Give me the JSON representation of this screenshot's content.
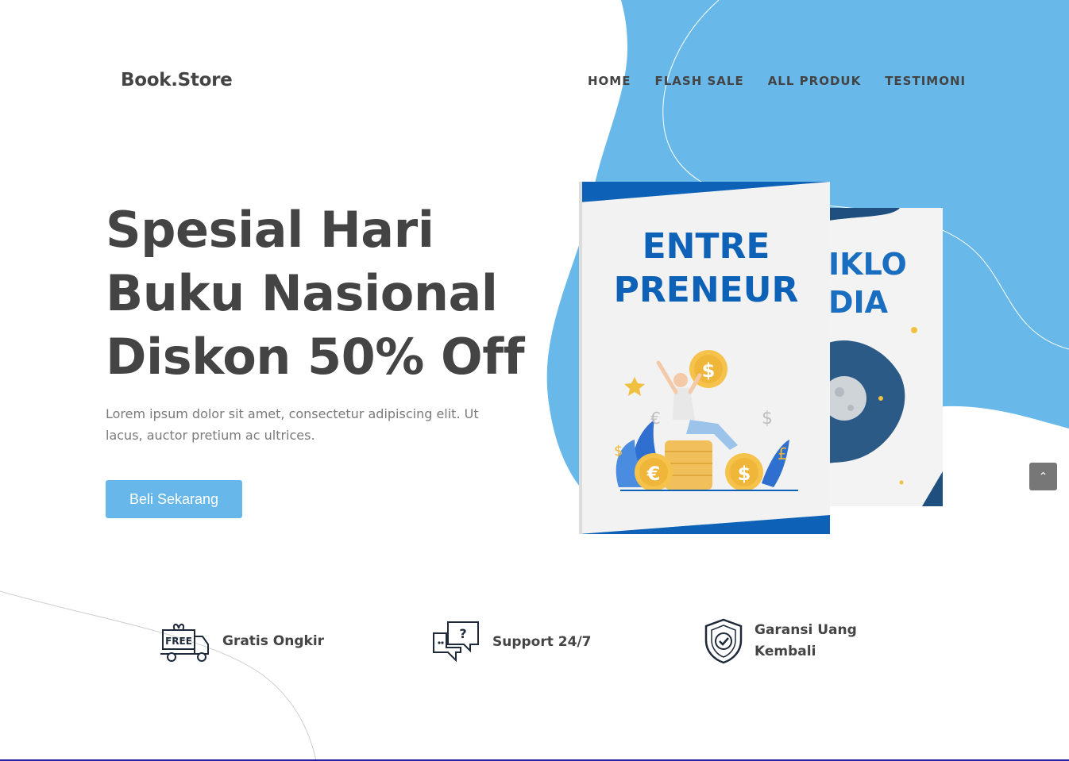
{
  "brand": {
    "logo": "Book.Store"
  },
  "nav": {
    "items": [
      "HOME",
      "FLASH SALE",
      "ALL PRODUK",
      "TESTIMONI"
    ]
  },
  "hero": {
    "title_lines": [
      "Spesial Hari",
      "Buku Nasional",
      "Diskon 50% Off"
    ],
    "description": "Lorem ipsum dolor sit amet, consectetur adipiscing elit. Ut lacus, auctor pretium ac ultrices.",
    "cta_label": "Beli Sekarang"
  },
  "books": {
    "front": {
      "title_line1": "ENTRE",
      "title_line2": "PRENEUR"
    },
    "back": {
      "title_line1": "IKLO",
      "title_line2": "DIA"
    }
  },
  "features": [
    {
      "icon": "free-delivery-truck-icon",
      "label": "Gratis Ongkir",
      "badge": "FREE"
    },
    {
      "icon": "support-chat-icon",
      "label": "Support 24/7"
    },
    {
      "icon": "shield-check-icon",
      "label_line1": "Garansi Uang",
      "label_line2": "Kembali"
    }
  ],
  "scroll_top": {
    "icon": "chevron-up-icon",
    "glyph": "⌃"
  },
  "colors": {
    "accent": "#67b7ea",
    "dark_text": "#444444",
    "muted_text": "#7a7a7a",
    "book_blue": "#0d62b8"
  }
}
